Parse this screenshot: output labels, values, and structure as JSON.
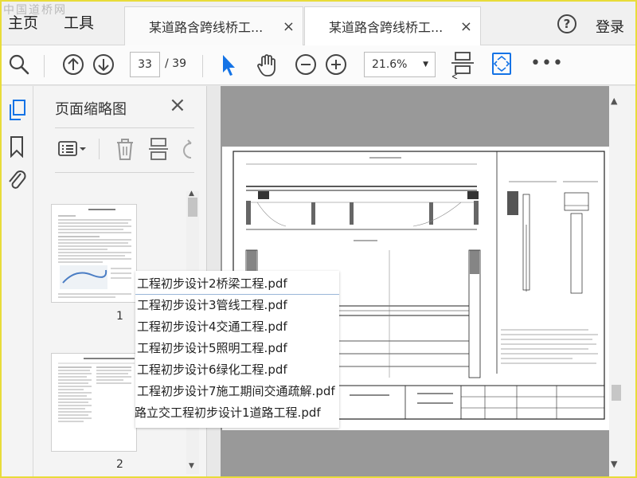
{
  "watermark": "中国道桥网",
  "menu": {
    "home": "主页",
    "tools": "工具"
  },
  "tabs": [
    {
      "label": "某道路含跨线桥工...",
      "close": "×"
    },
    {
      "label": "某道路含跨线桥工...",
      "close": "×"
    }
  ],
  "header": {
    "help": "?",
    "login": "登录"
  },
  "toolbar": {
    "current_page": "33",
    "total_pages": "/ 39",
    "zoom": "21.6%",
    "more": "•••",
    "icons": [
      "search-icon",
      "page-up-icon",
      "page-down-icon",
      "select-pointer-icon",
      "hand-tool-icon",
      "zoom-out-icon",
      "zoom-in-icon",
      "scroll-mode-icon",
      "fit-page-icon",
      "more-icon"
    ]
  },
  "rail": {
    "icons": [
      "pages-icon",
      "bookmark-icon",
      "attachment-icon"
    ]
  },
  "panel": {
    "title": "页面缩略图",
    "close": "×",
    "tools": [
      "thumbnail-options-icon",
      "delete-icon",
      "extract-icon",
      "undo-icon"
    ],
    "thumbnails": [
      {
        "page": "1"
      },
      {
        "page": "2"
      }
    ]
  },
  "popup": {
    "items": [
      "工程初步设计2桥梁工程.pdf",
      "工程初步设计3管线工程.pdf",
      "工程初步设计4交通工程.pdf",
      "工程初步设计5照明工程.pdf",
      "工程初步设计6绿化工程.pdf",
      "工程初步设计7施工期间交通疏解.pdf",
      "路立交工程初步设计1道路工程.pdf"
    ]
  },
  "colors": {
    "accent": "#1473e6",
    "frame": "#e8dc3a",
    "viewer_bg": "#999999"
  }
}
